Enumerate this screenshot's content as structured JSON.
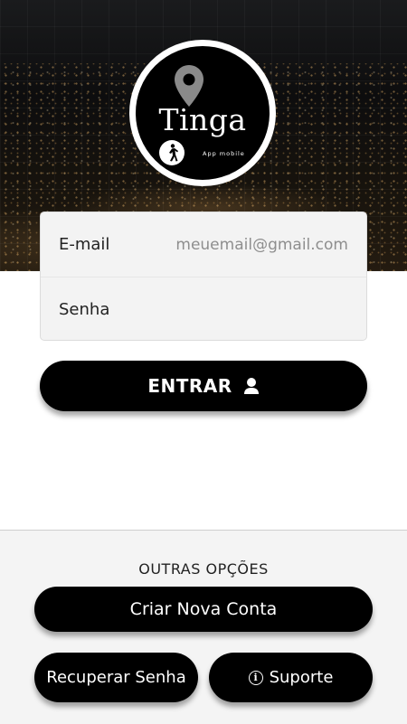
{
  "logo": {
    "brand": "Tinga",
    "subtitle": "App mobile",
    "icons": [
      "map-pin-icon",
      "pedestrian-icon"
    ]
  },
  "form": {
    "email_label": "E-mail",
    "email_placeholder": "meuemail@gmail.com",
    "email_value": "",
    "password_label": "Senha",
    "password_value": ""
  },
  "actions": {
    "enter_label": "ENTRAR",
    "enter_icon": "user-icon"
  },
  "others": {
    "title": "OUTRAS OPÇÕES",
    "create_account_label": "Criar Nova Conta",
    "recover_password_label": "Recuperar Senha",
    "support_label": "Suporte",
    "support_icon": "info-icon"
  },
  "colors": {
    "button_bg": "#000000",
    "panel_bg": "#f4f4f4",
    "card_bg": "#f3f3f3"
  }
}
